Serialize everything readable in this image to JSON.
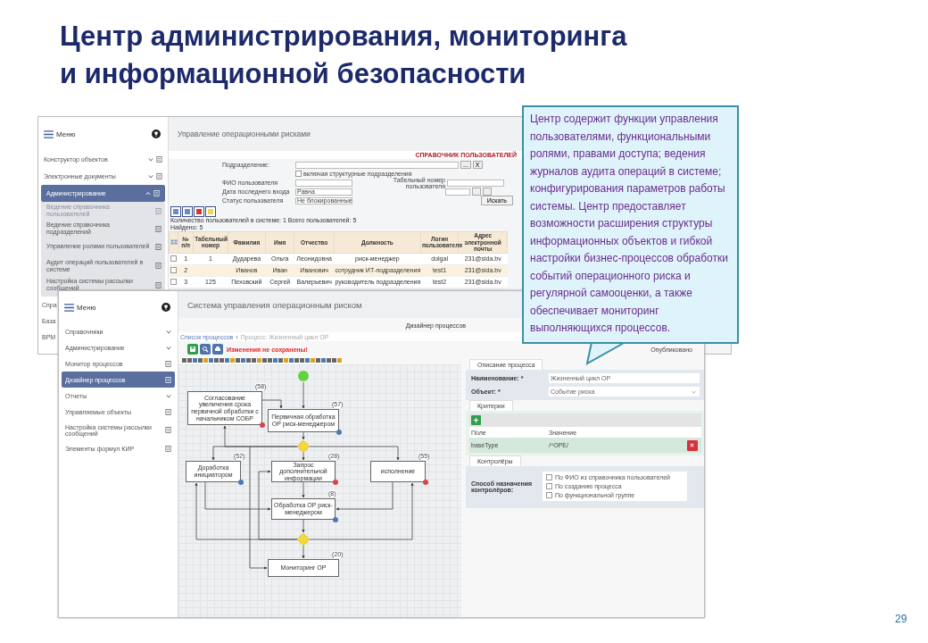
{
  "slide": {
    "title_lines": [
      "Центр администрирования, мониторинга",
      "и информационной безопасности"
    ],
    "page_number": "29"
  },
  "users_window": {
    "sidebar": {
      "title": "Меню",
      "items": [
        {
          "label": "Конструктор объектов",
          "kind": "group",
          "expanded": false,
          "selected": false
        },
        {
          "label": "Электронные документы",
          "kind": "group",
          "expanded": false,
          "selected": false
        },
        {
          "label": "Администрирование",
          "kind": "group",
          "expanded": true,
          "selected": true,
          "children": [
            {
              "label": "Ведение справочника пользователей",
              "selected": true
            },
            {
              "label": "Ведение справочника подразделений",
              "selected": false
            },
            {
              "label": "Управление ролями пользователей",
              "selected": false
            },
            {
              "label": "Аудит операций пользователей в системе",
              "selected": false
            },
            {
              "label": "Настройка системы рассылки сообщений",
              "selected": false
            }
          ]
        }
      ],
      "cut_items": [
        "Спра",
        "База",
        "BPM"
      ]
    },
    "header": "Управление операционными рисками",
    "form": {
      "title": "СПРАВОЧНИК ПОЛЬЗОВАТЕЛЕЙ",
      "department_label": "Подразделение:",
      "browse_button": "...",
      "clear_button": "X",
      "include_sub": {
        "label": "включая структурные подразделения",
        "checked": false
      },
      "name_label": "ФИО пользователя",
      "tab_label": "Табельный номер пользователя",
      "date_label": "Дата последнего входа",
      "date_op": "Равна",
      "status_label": "Статус пользователя",
      "status": "Не блокированные",
      "search_button": "Искать"
    },
    "counts": "Количество пользователей в системе: 1   Всего пользователей: 5",
    "found": "Найдено: 5",
    "table": {
      "columns": [
        "№ п/п",
        "Табельный номер",
        "Фамилия",
        "Имя",
        "Отчество",
        "Должность",
        "Логин пользователя",
        "Адрес электронной почты"
      ],
      "rows": [
        {
          "selected": false,
          "checked": false,
          "cells": [
            "1",
            "1",
            "Дударева",
            "Ольга",
            "Леонидовна",
            "риск-менеджер",
            "dolgal",
            "231@sida.bv"
          ]
        },
        {
          "selected": true,
          "checked": false,
          "cells": [
            "2",
            "",
            "Иванов",
            "Иван",
            "Иванович",
            "сотрудник ИТ-подразделения",
            "test1",
            "231@sida.bv"
          ]
        },
        {
          "selected": false,
          "checked": false,
          "cells": [
            "3",
            "125",
            "Пеховский",
            "Сергей",
            "Валерьевич",
            "руководитель подразделения",
            "test2",
            "231@sida.bv"
          ]
        }
      ]
    }
  },
  "designer_window": {
    "sidebar": {
      "title": "Меню",
      "items": [
        {
          "label": "Справочники",
          "kind": "group",
          "expanded": false,
          "selected": false
        },
        {
          "label": "Администрирование",
          "kind": "group",
          "expanded": false,
          "selected": false
        },
        {
          "label": "Монитор процессов",
          "kind": "link",
          "selected": false
        },
        {
          "label": "Дизайнер процессов",
          "kind": "link",
          "selected": true
        },
        {
          "label": "Отчеты",
          "kind": "group",
          "expanded": false,
          "selected": false
        },
        {
          "label": "Управляемые объекты",
          "kind": "link",
          "selected": false
        },
        {
          "label": "Настройка системы рассылки сообщений",
          "kind": "link",
          "selected": false
        },
        {
          "label": "Элементы формул КИР",
          "kind": "link",
          "selected": false
        }
      ]
    },
    "header": "Система управления операционным риском",
    "section": "Дизайнер процессов",
    "breadcrumb": [
      "Список процессов",
      "Процесс: Жизненный цикл ОР"
    ],
    "breadcrumb_separator": "›",
    "unsaved_message": "Изменения не сохранены!",
    "publish_status": "Опубликовано",
    "diagram": {
      "nodes": [
        {
          "label": "Согласование увеличения срока первичной обработки с начальником СОБР",
          "number": "(58)",
          "color": "#d9434f"
        },
        {
          "label": "Первичная обработка ОР риск-менеджером",
          "number": "(57)",
          "color": "#4a7bb7"
        },
        {
          "label": "Доработка инициатором",
          "number": "(52)",
          "color": "#4a7bb7"
        },
        {
          "label": "Запрос дополнительной информации",
          "number": "(28)",
          "color": "#d9434f"
        },
        {
          "label": "исполнение",
          "number": "(55)",
          "color": "#d9434f"
        },
        {
          "label": "Обработка ОР риск-менеджером",
          "number": "(8)",
          "color": "#4a7bb7"
        },
        {
          "label": "Мониторинг ОР",
          "number": "(20)"
        }
      ]
    },
    "properties": {
      "tab": "Описание процесса",
      "name_label": "Наименование: *",
      "name_value": "Жизненный цикл ОР",
      "object_label": "Объект: *",
      "object_value": "Событие риска",
      "criteria": {
        "title": "Критерии",
        "columns": [
          "Поле",
          "Значение"
        ],
        "rows": [
          {
            "cells": [
              "baseType",
              "/^OPE/"
            ]
          }
        ]
      },
      "controllers": {
        "title": "Контролёры",
        "label": "Способ назначения контролёров:",
        "options": [
          {
            "label": "По ФИО из справочника пользователей",
            "checked": false
          },
          {
            "label": "По созданию процесса",
            "checked": false
          },
          {
            "label": "По функциональной группе",
            "checked": false
          }
        ]
      }
    }
  },
  "callout": {
    "text": "Центр содержит функции управления пользователями, функциональными ролями, правами доступа; ведения журналов аудита операций в системе; конфигурирования параметров работы системы. Центр предоставляет возможности расширения структуры информационных объектов и гибкой настройки бизнес-процессов обработки событий операционного риска и регулярной самооценки, а также обеспечивает мониторинг выполняющихся процессов."
  }
}
